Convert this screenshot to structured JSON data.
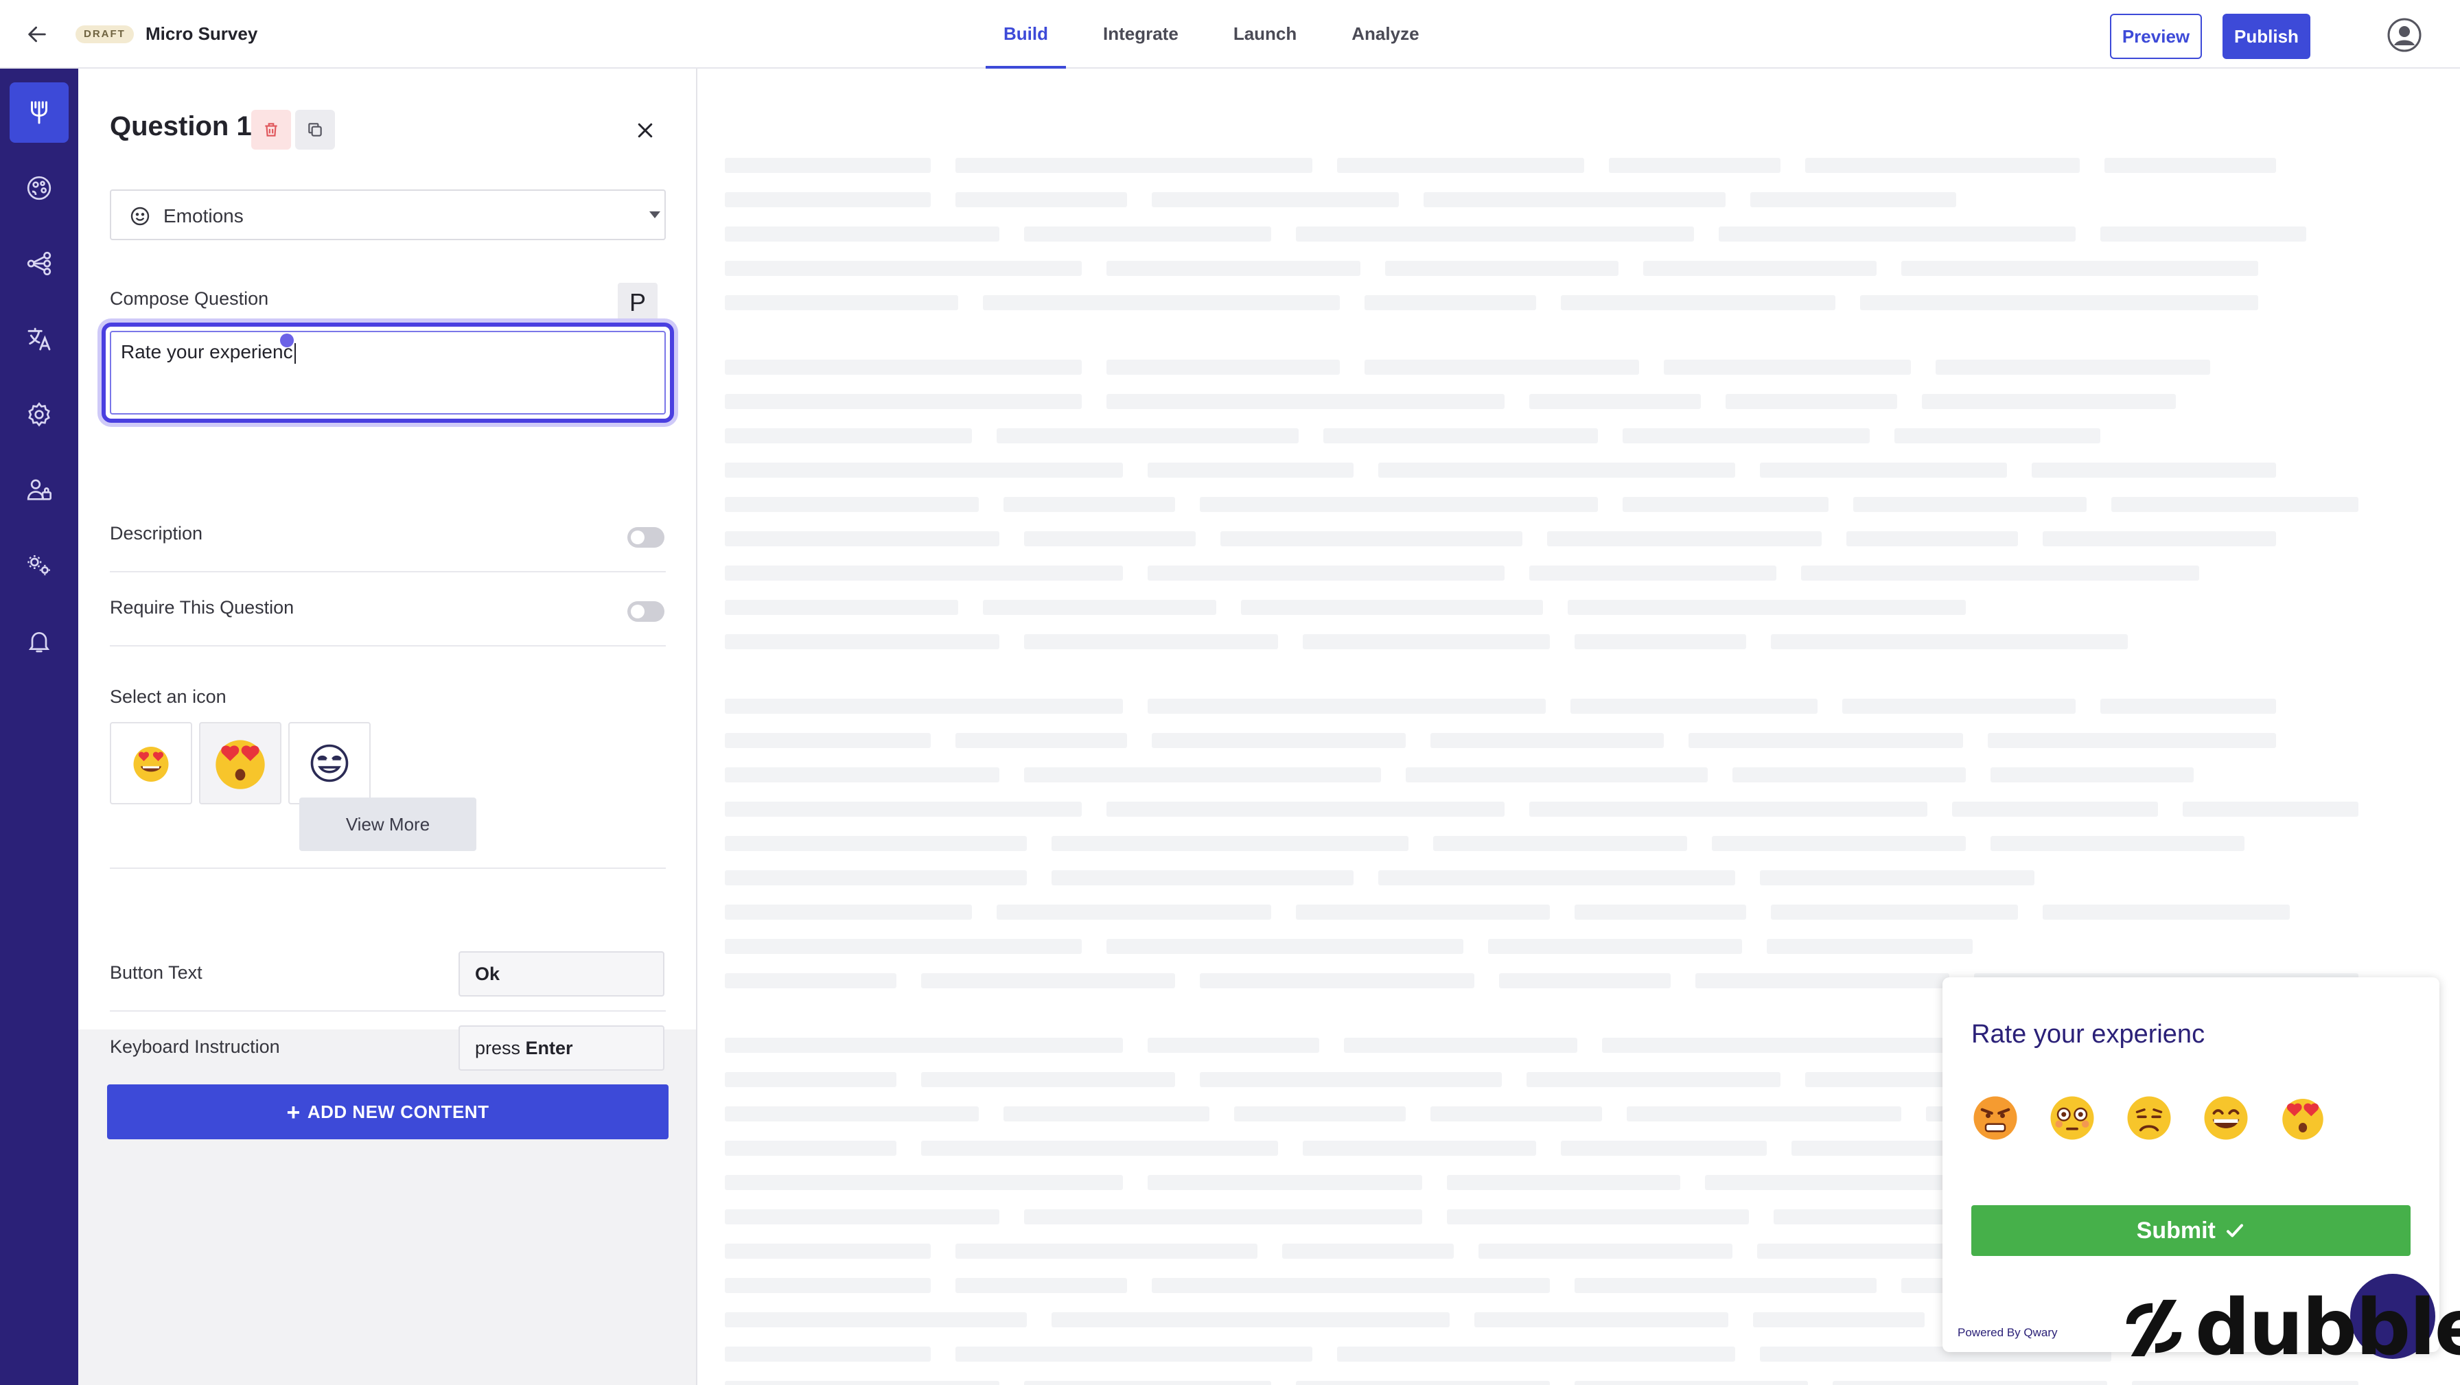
{
  "topbar": {
    "draft_badge": "DRAFT",
    "survey_title": "Micro Survey",
    "tabs": [
      {
        "label": "Build",
        "active": true
      },
      {
        "label": "Integrate",
        "active": false
      },
      {
        "label": "Launch",
        "active": false
      },
      {
        "label": "Analyze",
        "active": false
      }
    ],
    "preview_label": "Preview",
    "publish_label": "Publish"
  },
  "rail": {
    "items": [
      {
        "icon": "build-icon",
        "active": true
      },
      {
        "icon": "theme-icon",
        "active": false
      },
      {
        "icon": "logic-icon",
        "active": false
      },
      {
        "icon": "translate-icon",
        "active": false
      },
      {
        "icon": "settings-icon",
        "active": false
      },
      {
        "icon": "audience-icon",
        "active": false
      },
      {
        "icon": "integrations-icon",
        "active": false
      },
      {
        "icon": "notifications-icon",
        "active": false
      }
    ]
  },
  "editor": {
    "question_title": "Question 1",
    "question_type": "Emotions",
    "compose_label": "Compose Question",
    "p_button": "P",
    "question_text": "Rate your experienc",
    "description_label": "Description",
    "description_enabled": false,
    "require_label": "Require This Question",
    "require_enabled": false,
    "select_icon_label": "Select an icon",
    "icon_options": [
      "heart-eyes-icon",
      "heart-eyes-open-icon",
      "smile-outline-icon"
    ],
    "selected_icon": 1,
    "view_more_label": "View More",
    "button_text_label": "Button Text",
    "button_text_value": "Ok",
    "keyboard_label": "Keyboard Instruction",
    "keyboard_prefix": "press",
    "keyboard_key": "Enter",
    "add_content_label": "ADD NEW CONTENT"
  },
  "widget": {
    "question": "Rate your experienc",
    "emojis": [
      "angry-face-icon",
      "flushed-face-icon",
      "frowning-face-icon",
      "grinning-face-icon",
      "heart-eyes-face-icon"
    ],
    "submit_label": "Submit",
    "powered_by": "Powered By Qwary"
  },
  "watermark": "dubble",
  "colors": {
    "brand": "#3d4ad8",
    "rail": "#2b2178",
    "submit": "#46b04a",
    "draft_bg": "#f3ead1"
  }
}
